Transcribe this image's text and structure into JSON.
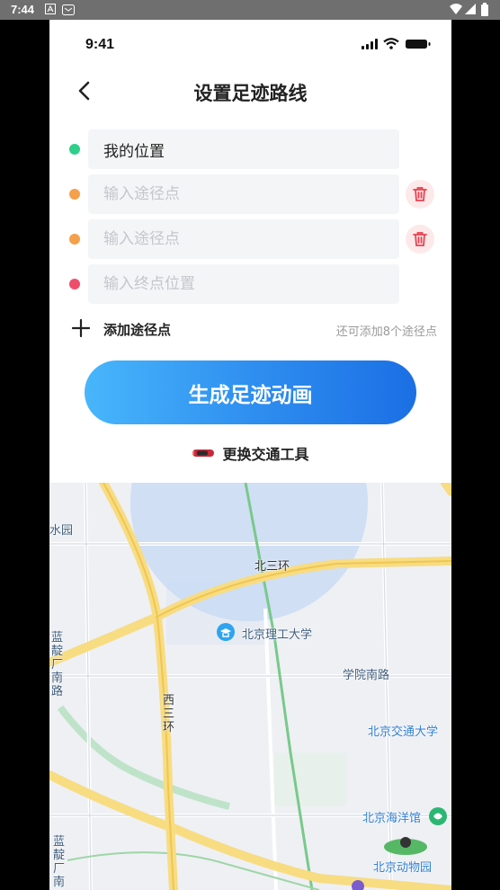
{
  "system_bar": {
    "time": "7:44"
  },
  "ios_status": {
    "time": "9:41"
  },
  "header": {
    "title": "设置足迹路线"
  },
  "route": {
    "start": {
      "value": "我的位置",
      "dot_color": "#2ecf8a"
    },
    "waypoints": [
      {
        "placeholder": "输入途径点",
        "dot_color": "#f5a04a"
      },
      {
        "placeholder": "输入途径点",
        "dot_color": "#f5a04a"
      }
    ],
    "end": {
      "placeholder": "输入终点位置",
      "dot_color": "#f04d6a"
    },
    "add_waypoint_label": "添加途径点",
    "remaining_hint": "还可添加8个途径点"
  },
  "generate_button": {
    "label": "生成足迹动画"
  },
  "change_transport": {
    "label": "更换交通工具"
  },
  "map": {
    "labels": {
      "third_ring_north": "北三环",
      "bit": "北京理工大学",
      "xueyuan_south": "学院南路",
      "third_ring_west": "西三环",
      "bjtu": "北京交通大学",
      "aquarium": "北京海洋馆",
      "zoo": "北京动物园",
      "water_park": "水园",
      "landian_south_1": "蓝靛厂南路",
      "landian_south_2": "蓝靛厂南"
    }
  },
  "colors": {
    "accent": "#2f8ff0",
    "delete": "#e8424f",
    "main_road": "#f5d26a"
  }
}
